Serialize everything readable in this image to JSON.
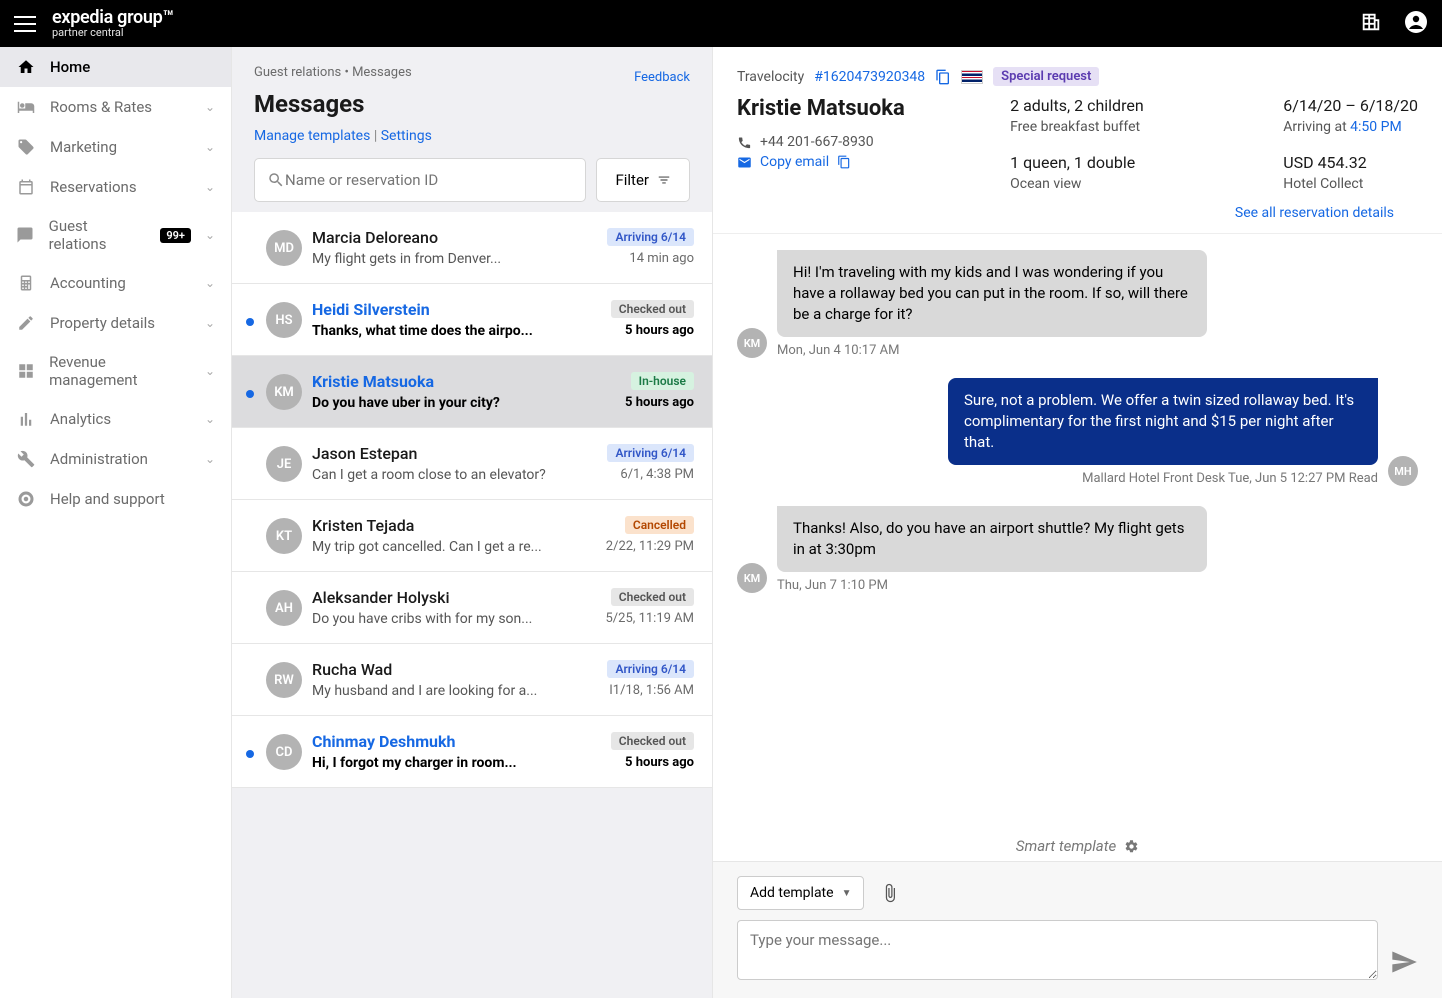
{
  "brand": {
    "line1": "expedia group™",
    "line2": "partner central"
  },
  "sidebar": [
    {
      "label": "Home",
      "icon": "home",
      "active": true
    },
    {
      "label": "Rooms & Rates",
      "icon": "bed",
      "expand": true
    },
    {
      "label": "Marketing",
      "icon": "tag",
      "expand": true
    },
    {
      "label": "Reservations",
      "icon": "calendar",
      "expand": true
    },
    {
      "label": "Guest relations",
      "icon": "chat",
      "expand": true,
      "badge": "99+"
    },
    {
      "label": "Accounting",
      "icon": "calc",
      "expand": true
    },
    {
      "label": "Property details",
      "icon": "pencil",
      "expand": true
    },
    {
      "label": "Revenue management",
      "icon": "boxes",
      "expand": true
    },
    {
      "label": "Analytics",
      "icon": "bars",
      "expand": true
    },
    {
      "label": "Administration",
      "icon": "wrench",
      "expand": true
    },
    {
      "label": "Help and support",
      "icon": "life"
    }
  ],
  "breadcrumb": "Guest relations  •   Messages",
  "page_title": "Messages",
  "links": {
    "manage": "Manage templates",
    "settings": "Settings"
  },
  "search_placeholder": "Name or reservation ID",
  "filter_label": "Filter",
  "feedback": "Feedback",
  "conversations": [
    {
      "initials": "MD",
      "name": "Marcia Deloreano",
      "preview": "My flight gets in from Denver...",
      "status": "Arriving 6/14",
      "status_class": "st-arriving",
      "time": "14 min ago",
      "unread": false
    },
    {
      "initials": "HS",
      "name": "Heidi Silverstein",
      "preview": "Thanks, what time does the airpo...",
      "status": "Checked out",
      "status_class": "st-checkedout",
      "time": "5 hours ago",
      "unread": true
    },
    {
      "initials": "KM",
      "name": "Kristie Matsuoka",
      "preview": "Do you have uber in your city?",
      "status": "In-house",
      "status_class": "st-inhouse",
      "time": "5 hours ago",
      "unread": true,
      "selected": true
    },
    {
      "initials": "JE",
      "name": "Jason Estepan",
      "preview": "Can I get a room close to an elevator?",
      "status": "Arriving 6/14",
      "status_class": "st-arriving",
      "time": "6/1, 4:38 PM",
      "unread": false
    },
    {
      "initials": "KT",
      "name": "Kristen Tejada",
      "preview": "My trip got cancelled. Can I get a re...",
      "status": "Cancelled",
      "status_class": "st-cancelled",
      "time": "2/22, 11:29 PM",
      "unread": false
    },
    {
      "initials": "AH",
      "name": "Aleksander Holyski",
      "preview": "Do you have cribs with for my son...",
      "status": "Checked out",
      "status_class": "st-checkedout",
      "time": "5/25, 11:19 AM",
      "unread": false
    },
    {
      "initials": "RW",
      "name": "Rucha Wad",
      "preview": "My husband and I are looking for a...",
      "status": "Arriving 6/14",
      "status_class": "st-arriving",
      "time": "I1/18, 1:56 AM",
      "unread": false
    },
    {
      "initials": "CD",
      "name": "Chinmay Deshmukh",
      "preview": "Hi, I forgot my charger in room...",
      "status": "Checked out",
      "status_class": "st-checkedout",
      "time": "5 hours ago",
      "unread": true
    }
  ],
  "reservation": {
    "source": "Travelocity",
    "id": "#1620473920348",
    "special": "Special request",
    "guest_name": "Kristie Matsuoka",
    "phone": "+44 201-667-8930",
    "copy_email": "Copy email",
    "occupancy": "2 adults, 2 children",
    "meal": "Free breakfast buffet",
    "beds": "1 queen, 1 double",
    "view": "Ocean view",
    "dates": "6/14/20 – 6/18/20",
    "arriving_prefix": "Arriving at ",
    "arriving_time": "4:50 PM",
    "amount": "USD 454.32",
    "collect": "Hotel Collect",
    "see_all": "See all reservation details"
  },
  "messages": [
    {
      "dir": "in",
      "avatar": "KM",
      "text": "Hi! I'm traveling with my kids and I was wondering if you have a rollaway bed you can put in the room. If so, will there be a charge for it?",
      "meta": "Mon, Jun 4 10:17 AM"
    },
    {
      "dir": "out",
      "avatar": "MH",
      "text": "Sure, not a problem. We offer a twin sized rollaway bed. It's complimentary for the first night and $15 per night after that.",
      "meta": "Mallard Hotel Front Desk   Tue, Jun 5 12:27 PM   Read"
    },
    {
      "dir": "in",
      "avatar": "KM",
      "text": "Thanks! Also, do you have an airport shuttle? My flight gets in at 3:30pm",
      "meta": "Thu, Jun 7 1:10 PM"
    }
  ],
  "smart_template": "Smart template",
  "add_template": "Add template",
  "compose_placeholder": "Type your message..."
}
